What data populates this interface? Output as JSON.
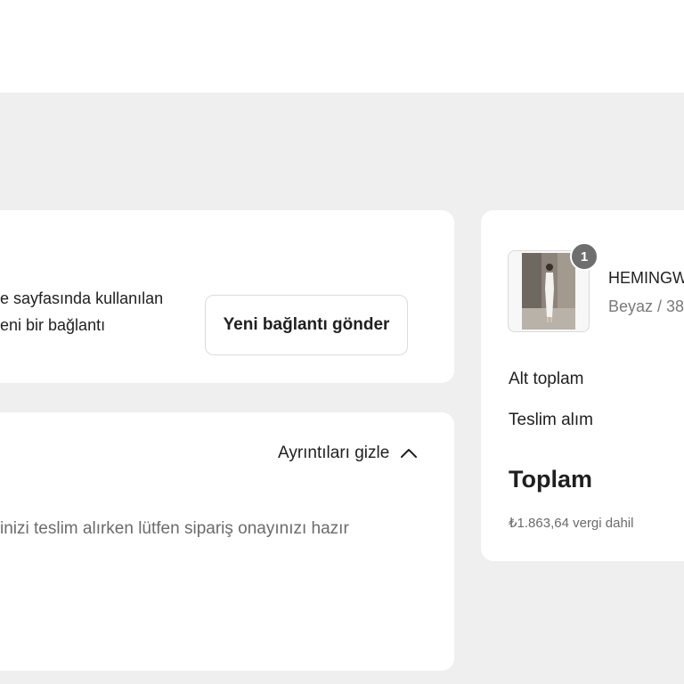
{
  "link_card": {
    "text_line1": "e sayfasında kullanılan",
    "text_line2": "eni bir bağlantı",
    "send_button_label": "Yeni bağlantı gönder"
  },
  "details_card": {
    "toggle_label": "Ayrıntıları gizle",
    "note": "inizi teslim alırken lütfen sipariş onayınızı hazır"
  },
  "summary": {
    "product": {
      "quantity": "1",
      "name": "HEMINGW",
      "variant": "Beyaz / 38"
    },
    "subtotal_label": "Alt toplam",
    "pickup_label": "Teslim alım",
    "total_label": "Toplam",
    "tax_note": "₺1.863,64 vergi dahil"
  },
  "icons": {
    "toggle": "chevron-up-icon"
  }
}
